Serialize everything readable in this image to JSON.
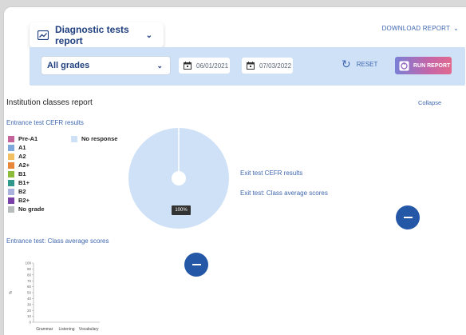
{
  "header": {
    "report_select": "Diagnostic tests report",
    "download": "DOWNLOAD REPORT"
  },
  "filters": {
    "grades": "All grades",
    "date_from": "06/01/2021",
    "date_to": "07/03/2022",
    "reset": "RESET",
    "run": "RUN REPORT"
  },
  "section": {
    "title": "Institution classes report",
    "collapse": "Collapse"
  },
  "entrance_cefr": {
    "title": "Entrance test CEFR results",
    "legend": [
      {
        "label": "Pre-A1",
        "color": "#c5649a"
      },
      {
        "label": "A1",
        "color": "#7ea7dc"
      },
      {
        "label": "A2",
        "color": "#f2c063"
      },
      {
        "label": "A2+",
        "color": "#e8873a"
      },
      {
        "label": "B1",
        "color": "#8dbb3c"
      },
      {
        "label": "B1+",
        "color": "#2f9a8c"
      },
      {
        "label": "B2",
        "color": "#a8b2dd"
      },
      {
        "label": "B2+",
        "color": "#7b3fa8"
      },
      {
        "label": "No grade",
        "color": "#b8bcbd"
      }
    ],
    "no_response": {
      "label": "No response",
      "color": "#cfe1f7"
    },
    "pie_label": "100%"
  },
  "chart_data": {
    "type": "bar",
    "categories": [
      "Grammar",
      "Listening",
      "Vocabulary"
    ],
    "values": [
      0,
      0,
      0
    ],
    "ylabel": "%",
    "ylim": [
      0,
      100
    ],
    "yticks": [
      0,
      10,
      20,
      30,
      40,
      50,
      60,
      70,
      80,
      90,
      100
    ]
  },
  "exit": {
    "cefr_title": "Exit test CEFR results",
    "avg_title": "Exit test: Class average scores"
  },
  "entrance_avg": {
    "title": "Entrance test: Class average scores"
  },
  "colors": {
    "accent": "#3f67b0",
    "button": "#2557a7",
    "filterbar": "#cfe1f7"
  }
}
